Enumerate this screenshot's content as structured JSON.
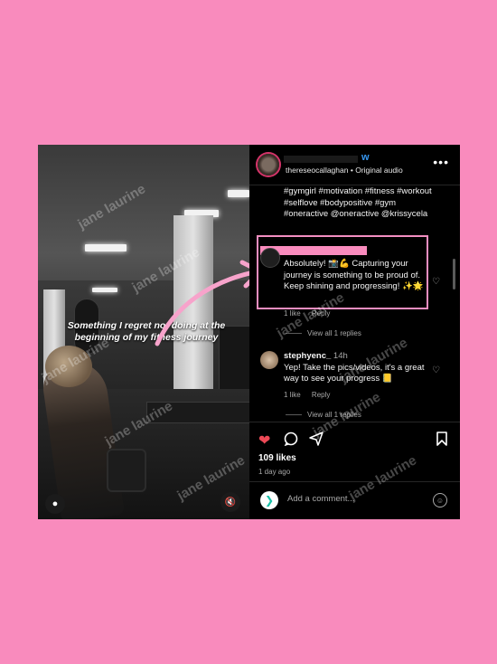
{
  "overlay_text": "Something I regret not doing at the beginning of my fitness journey",
  "watermark": "jane laurine",
  "header": {
    "follow_fragment": "w",
    "username": "thereseocallaghan",
    "separator": "•",
    "audio": "Original audio",
    "more_icon": "•••"
  },
  "caption": "#gymgirl #motivation #fitness #workout #selflove #bodypositive #gym #oneractive @oneractive @krissycela",
  "comments": [
    {
      "text": "Absolutely! 📸💪 Capturing your journey is something to be proud of. Keep shining and progressing! ✨🌟",
      "likes": "1 like",
      "reply": "Reply",
      "view_replies": "View all 1 replies"
    },
    {
      "username": "stephyenc_",
      "time": "14h",
      "text": "Yep! Take the pics/videos, it's a great way to see your progress 📒",
      "likes": "1 like",
      "reply": "Reply",
      "view_replies": "View all 1 replies"
    }
  ],
  "stats": {
    "likes": "109 likes",
    "date": "1 day ago"
  },
  "add_comment": {
    "placeholder": "Add a comment..."
  },
  "colors": {
    "background": "#f98bbd",
    "highlight_box": "#f28ec1",
    "heart": "#ed4956",
    "link": "#3797f0"
  }
}
